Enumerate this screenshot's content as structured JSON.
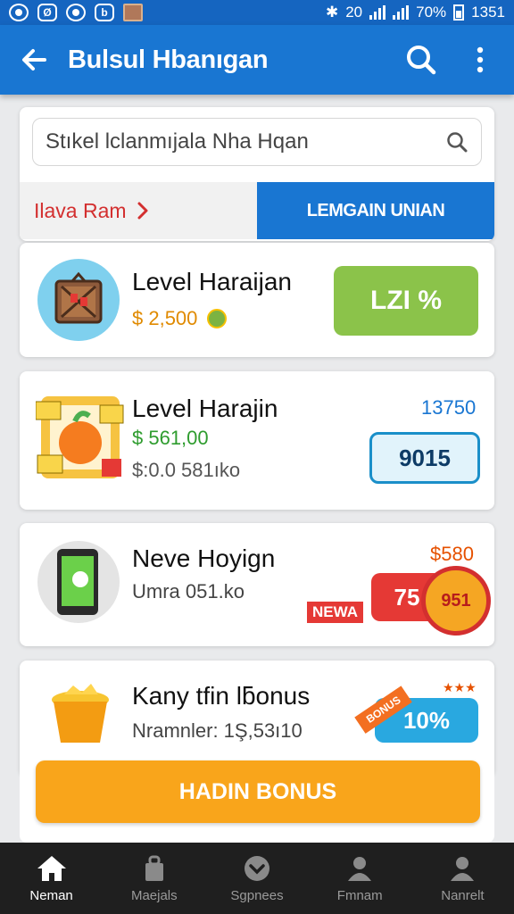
{
  "status_bar": {
    "time": "1351",
    "signal_text": "20",
    "battery_pct": "70%"
  },
  "app_bar": {
    "title": "Bulsul Hbanıgan",
    "back_icon": "arrow-left-icon",
    "search_icon": "search-icon",
    "menu_icon": "more-vert-icon"
  },
  "search": {
    "value": "Stıkel lclanmıjala Nha Hqan"
  },
  "tabs": {
    "left_label": "Ilava Ram",
    "right_label": "LEMGAIN UNIAN"
  },
  "cards": [
    {
      "title": "Level Haraijan",
      "price": "$ 2,500",
      "badge": "LZI %",
      "icon": "crate-icon"
    },
    {
      "title": "Level Harajin",
      "price": "$ 561,00",
      "sub": "$:0.0 581ıko",
      "top_value": "13750",
      "badge": "9015",
      "icon": "fruit-tickets-icon"
    },
    {
      "title": "Neve Hoyign",
      "sub": "Umra 051.ko",
      "top_value": "$580",
      "new_label": "NEWA",
      "badge": "75",
      "seal_value": "951",
      "icon": "phone-icon"
    },
    {
      "title": "Kany tfin lƃonus",
      "sub": "Nramnler: 1Ş,53ı10",
      "ribbon_label": "BONUS",
      "badge": "10%",
      "icon": "gold-basket-icon"
    }
  ],
  "cta": {
    "label": "HADIN BONUS"
  },
  "bottom_nav": [
    {
      "label": "Neman",
      "icon": "home-icon",
      "active": true
    },
    {
      "label": "Maejals",
      "icon": "bag-icon",
      "active": false
    },
    {
      "label": "Sgpnees",
      "icon": "chevron-circle-icon",
      "active": false
    },
    {
      "label": "Fmnam",
      "icon": "person-icon",
      "active": false
    },
    {
      "label": "Nanrelt",
      "icon": "profile-icon",
      "active": false
    }
  ],
  "colors": {
    "primary": "#1976d2",
    "green_badge": "#8bc34a",
    "cta": "#f9a51b",
    "red": "#e53935"
  }
}
